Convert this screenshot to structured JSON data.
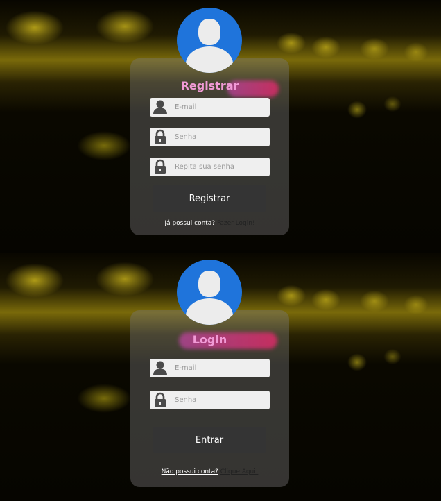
{
  "register": {
    "title": "Registrar",
    "email_placeholder": "E-mail",
    "password_placeholder": "Senha",
    "repeat_placeholder": "Repita sua senha",
    "submit_label": "Registrar",
    "footer_question": "Já possui conta?",
    "footer_link": "Fazer Login!"
  },
  "login": {
    "title": "Login",
    "email_placeholder": "E-mail",
    "password_placeholder": "Senha",
    "submit_label": "Entrar",
    "footer_question": "Não possui conta?",
    "footer_link": "Clique Aqui!"
  },
  "icons": {
    "avatar": "user-avatar-icon",
    "email": "user-icon",
    "password": "lock-icon"
  },
  "colors": {
    "avatar_bg": "#1f74db",
    "title_text": "#f19ad6",
    "button_bg": "#343434",
    "field_bg": "#efefef"
  }
}
